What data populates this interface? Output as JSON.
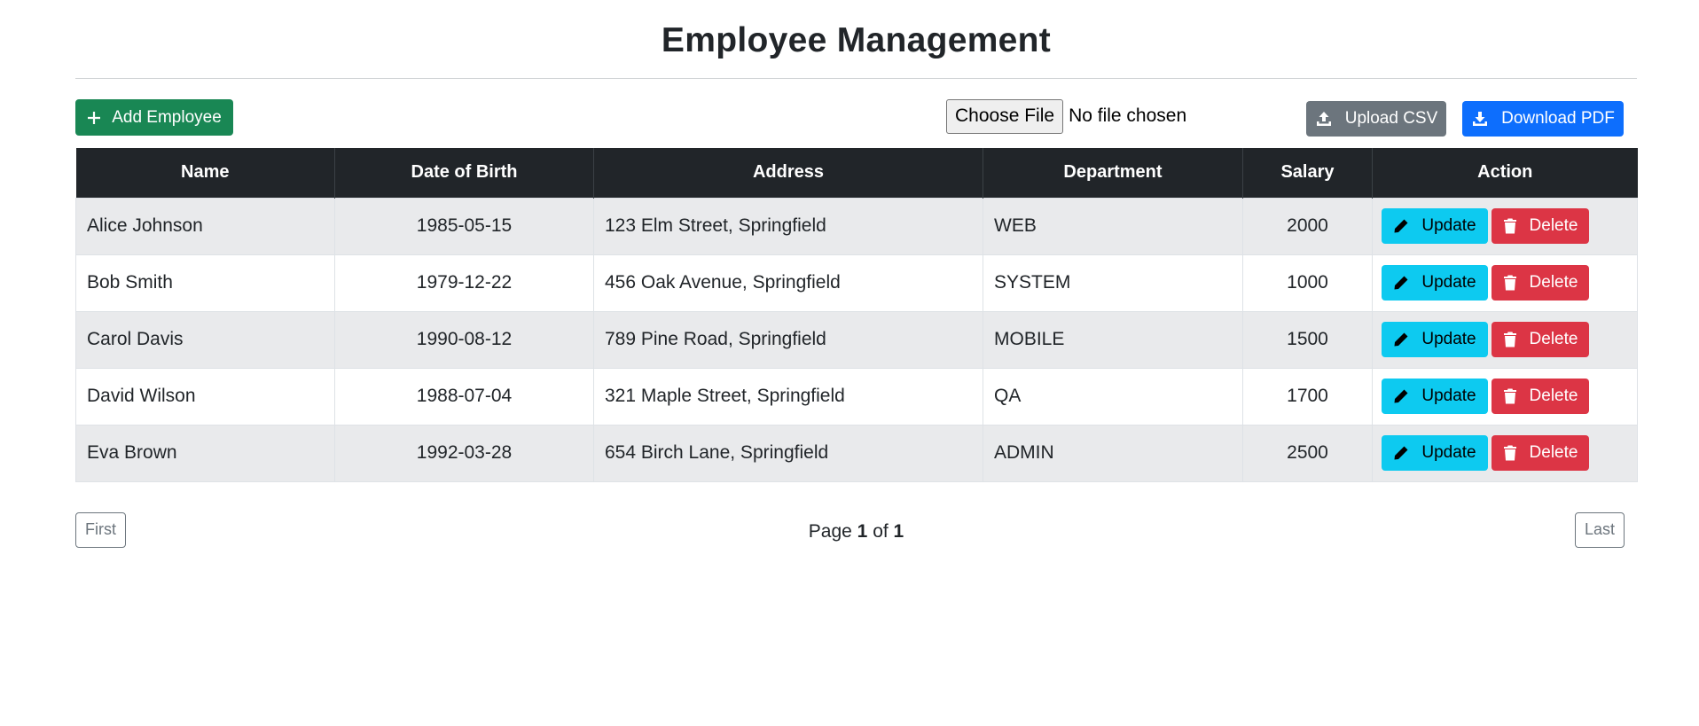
{
  "title": "Employee Management",
  "toolbar": {
    "add_label": "Add Employee",
    "file_button": "Choose File",
    "file_status": "No file chosen",
    "upload_label": "Upload CSV",
    "download_label": "Download PDF"
  },
  "table": {
    "headers": [
      "Name",
      "Date of Birth",
      "Address",
      "Department",
      "Salary",
      "Action"
    ],
    "rows": [
      {
        "name": "Alice Johnson",
        "dob": "1985-05-15",
        "address": "123 Elm Street, Springfield",
        "department": "WEB",
        "salary": "2000"
      },
      {
        "name": "Bob Smith",
        "dob": "1979-12-22",
        "address": "456 Oak Avenue, Springfield",
        "department": "SYSTEM",
        "salary": "1000"
      },
      {
        "name": "Carol Davis",
        "dob": "1990-08-12",
        "address": "789 Pine Road, Springfield",
        "department": "MOBILE",
        "salary": "1500"
      },
      {
        "name": "David Wilson",
        "dob": "1988-07-04",
        "address": "321 Maple Street, Springfield",
        "department": "QA",
        "salary": "1700"
      },
      {
        "name": "Eva Brown",
        "dob": "1992-03-28",
        "address": "654 Birch Lane, Springfield",
        "department": "ADMIN",
        "salary": "2500"
      }
    ],
    "update_label": "Update",
    "delete_label": "Delete"
  },
  "pagination": {
    "first_label": "First",
    "last_label": "Last",
    "page_word": "Page",
    "of_word": "of",
    "current": "1",
    "total": "1"
  },
  "colors": {
    "add": "#198754",
    "upload": "#6c757d",
    "download": "#0d6efd",
    "update": "#0dcaf0",
    "delete": "#dc3545",
    "header_bg": "#212529"
  },
  "icons": {
    "add": "plus-icon",
    "upload": "upload-icon",
    "download": "download-icon",
    "update": "pencil-icon",
    "delete": "trash-icon"
  }
}
